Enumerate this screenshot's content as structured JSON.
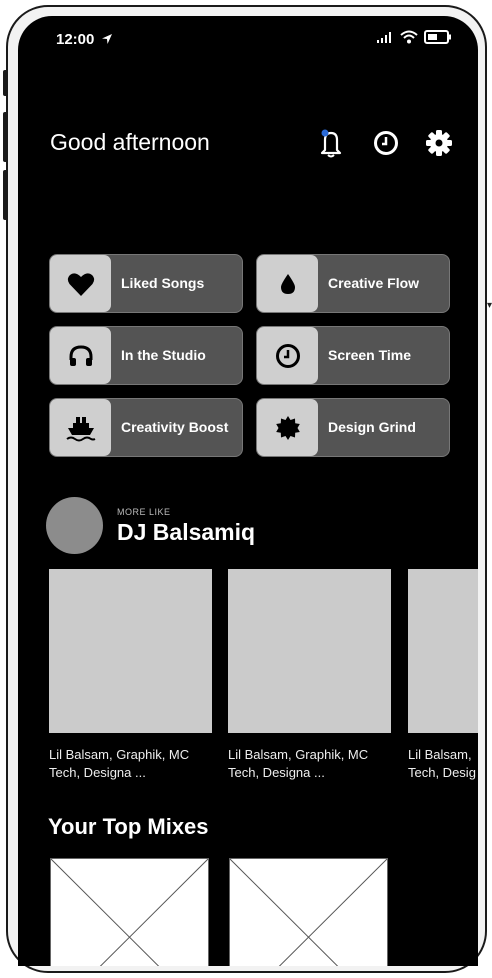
{
  "status_bar": {
    "time": "12:00"
  },
  "header": {
    "greeting": "Good afternoon"
  },
  "icons": {
    "location": "location-arrow-icon",
    "signal": "signal-bars-icon",
    "wifi": "wifi-icon",
    "battery": "battery-icon",
    "notifications": "bell-icon",
    "history": "clock-icon",
    "settings": "gear-icon"
  },
  "colors": {
    "background": "#000000",
    "tile": "#545454",
    "tile_art": "#cfcfcf",
    "notification_dot": "#2a6ad8"
  },
  "shortcuts": [
    {
      "label": "Liked Songs",
      "icon": "heart-icon"
    },
    {
      "label": "Creative Flow",
      "icon": "drop-icon"
    },
    {
      "label": "In the Studio",
      "icon": "headphones-icon"
    },
    {
      "label": "Screen Time",
      "icon": "clock-icon"
    },
    {
      "label": "Creativity Boost",
      "icon": "ship-icon"
    },
    {
      "label": "Design Grind",
      "icon": "badge-icon"
    }
  ],
  "more_like": {
    "caption": "MORE LIKE",
    "artist": "DJ Balsamiq"
  },
  "playlists": [
    {
      "line1": "Lil Balsam, Graphik, MC",
      "line2": "Tech, Designa ..."
    },
    {
      "line1": "Lil Balsam, Graphik, MC",
      "line2": "Tech, Designa ..."
    },
    {
      "line1": "Lil Balsam,",
      "line2": "Tech, Desig"
    }
  ],
  "top_mixes": {
    "title": "Your Top Mixes"
  }
}
